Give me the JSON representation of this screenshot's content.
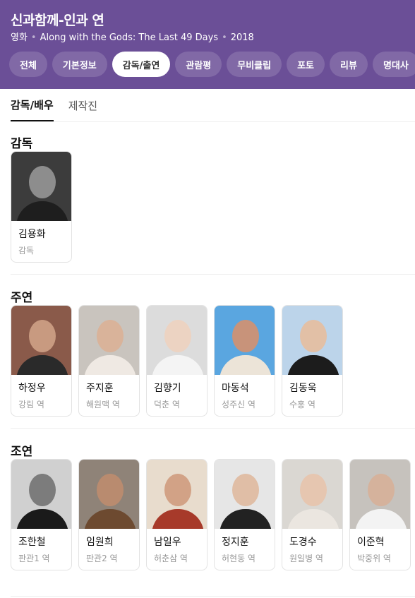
{
  "header": {
    "title": "신과함께-인과 연",
    "meta": {
      "genre": "영화",
      "english_title": "Along with the Gods: The Last 49 Days",
      "year": "2018"
    },
    "tabs": [
      {
        "label": "전체",
        "active": false
      },
      {
        "label": "기본정보",
        "active": false
      },
      {
        "label": "감독/출연",
        "active": true
      },
      {
        "label": "관람평",
        "active": false
      },
      {
        "label": "무비클립",
        "active": false
      },
      {
        "label": "포토",
        "active": false
      },
      {
        "label": "리뷰",
        "active": false
      },
      {
        "label": "명대사",
        "active": false
      }
    ]
  },
  "subtabs": [
    {
      "label": "감독/배우",
      "active": true
    },
    {
      "label": "제작진",
      "active": false
    }
  ],
  "sections": {
    "director": {
      "title": "감독",
      "people": [
        {
          "name": "김용화",
          "role": "감독",
          "bg": "#3c3c3c",
          "skin": "#8d8d8d",
          "cloth": "#1e1e1e"
        }
      ]
    },
    "main": {
      "title": "주연",
      "people": [
        {
          "name": "하정우",
          "role": "강림 역",
          "bg": "#8a5a4a",
          "skin": "#c89a80",
          "cloth": "#2a2a2a"
        },
        {
          "name": "주지훈",
          "role": "해원맥 역",
          "bg": "#c9c4be",
          "skin": "#d9b39a",
          "cloth": "#efe9e3"
        },
        {
          "name": "김향기",
          "role": "덕춘 역",
          "bg": "#dcdcdc",
          "skin": "#ecd3c2",
          "cloth": "#f4f4f4"
        },
        {
          "name": "마동석",
          "role": "성주신 역",
          "bg": "#5aa6e0",
          "skin": "#c8937a",
          "cloth": "#ece4d8"
        },
        {
          "name": "김동욱",
          "role": "수홍 역",
          "bg": "#bcd4ea",
          "skin": "#e2c0a6",
          "cloth": "#1c1c1c"
        }
      ]
    },
    "supporting": {
      "title": "조연",
      "people": [
        {
          "name": "조한철",
          "role": "판관1 역",
          "bg": "#d0d0d0",
          "skin": "#7c7c7c",
          "cloth": "#1a1a1a"
        },
        {
          "name": "임원희",
          "role": "판관2 역",
          "bg": "#8f8378",
          "skin": "#b98b6f",
          "cloth": "#6d4a30"
        },
        {
          "name": "남일우",
          "role": "허춘삼 역",
          "bg": "#e8dccd",
          "skin": "#d2a286",
          "cloth": "#a73a2a"
        },
        {
          "name": "정지훈",
          "role": "허현동 역",
          "bg": "#e6e6e6",
          "skin": "#e0bea6",
          "cloth": "#222222"
        },
        {
          "name": "도경수",
          "role": "원일병 역",
          "bg": "#dad7d2",
          "skin": "#e6c6b0",
          "cloth": "#ebe6e0"
        },
        {
          "name": "이준혁",
          "role": "박중위 역",
          "bg": "#c6c2bd",
          "skin": "#d5b29c",
          "cloth": "#f3f3f3"
        }
      ]
    }
  }
}
